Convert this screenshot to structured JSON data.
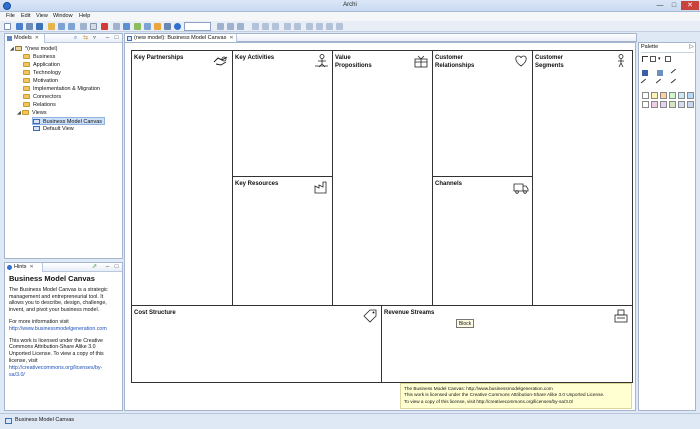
{
  "window": {
    "title": "Archi",
    "minimize": "—",
    "maximize": "□",
    "close": "✕"
  },
  "menu": [
    "File",
    "Edit",
    "View",
    "Window",
    "Help"
  ],
  "toolbar": {
    "zoom_value": ""
  },
  "models_panel": {
    "tab_label": "Models",
    "tree": {
      "model": "*(new model)",
      "folders": [
        "Business",
        "Application",
        "Technology",
        "Motivation",
        "Implementation & Migration",
        "Connectors",
        "Relations",
        "Views"
      ],
      "views": [
        "Business Model Canvas",
        "Default View"
      ]
    }
  },
  "hints_panel": {
    "tab_label": "Hints",
    "title": "Business Model Canvas",
    "paragraph1": "The Business Model Canvas is a strategic management and entrepreneurial tool. It allows you to describe, design, challenge, invent, and pivot your business model.",
    "info_label": "For more information visit",
    "info_link": "http://www.businessmodelgeneration.com",
    "license_text": "This work is licensed under the Creative Commons Attribution-Share Alike 3.0 Unported License. To view a copy of this license, visit",
    "license_link": "http://creativecommons.org/licenses/by-sa/3.0/"
  },
  "editor": {
    "tab_label": "(new model): Business Model Canvas",
    "blocks": {
      "key_partnerships": "Key Partnerships",
      "key_activities": "Key Activities",
      "value_propositions": "Value\nPropositions",
      "customer_relationships": "Customer\nRelationships",
      "customer_segments": "Customer\nSegments",
      "key_resources": "Key Resources",
      "channels": "Channels",
      "cost_structure": "Cost Structure",
      "revenue_streams": "Revenue Streams"
    },
    "tooltip": "Block",
    "note": {
      "line1": "The Business Model Canvas: http://www.businessmodelgeneration.com",
      "line2": "This work is licensed under the Creative Commons Attribution-Share Alike 3.0 Unported License.",
      "line3": "To view a copy of this license, visit http://creativecommons.org/licenses/by-sa/3.0/"
    }
  },
  "palette": {
    "title": "Palette",
    "swatch_colors": [
      "#ffffff",
      "#fff3b0",
      "#ffd0a0",
      "#d5f5d0",
      "#c8ecf7",
      "#b9d7f7",
      "#ffffff",
      "#f2cde8",
      "#e5d2f5",
      "#d8e6c4",
      "#d2ddef",
      "#c9d7f0"
    ]
  },
  "status": {
    "text": "Business Model Canvas"
  }
}
